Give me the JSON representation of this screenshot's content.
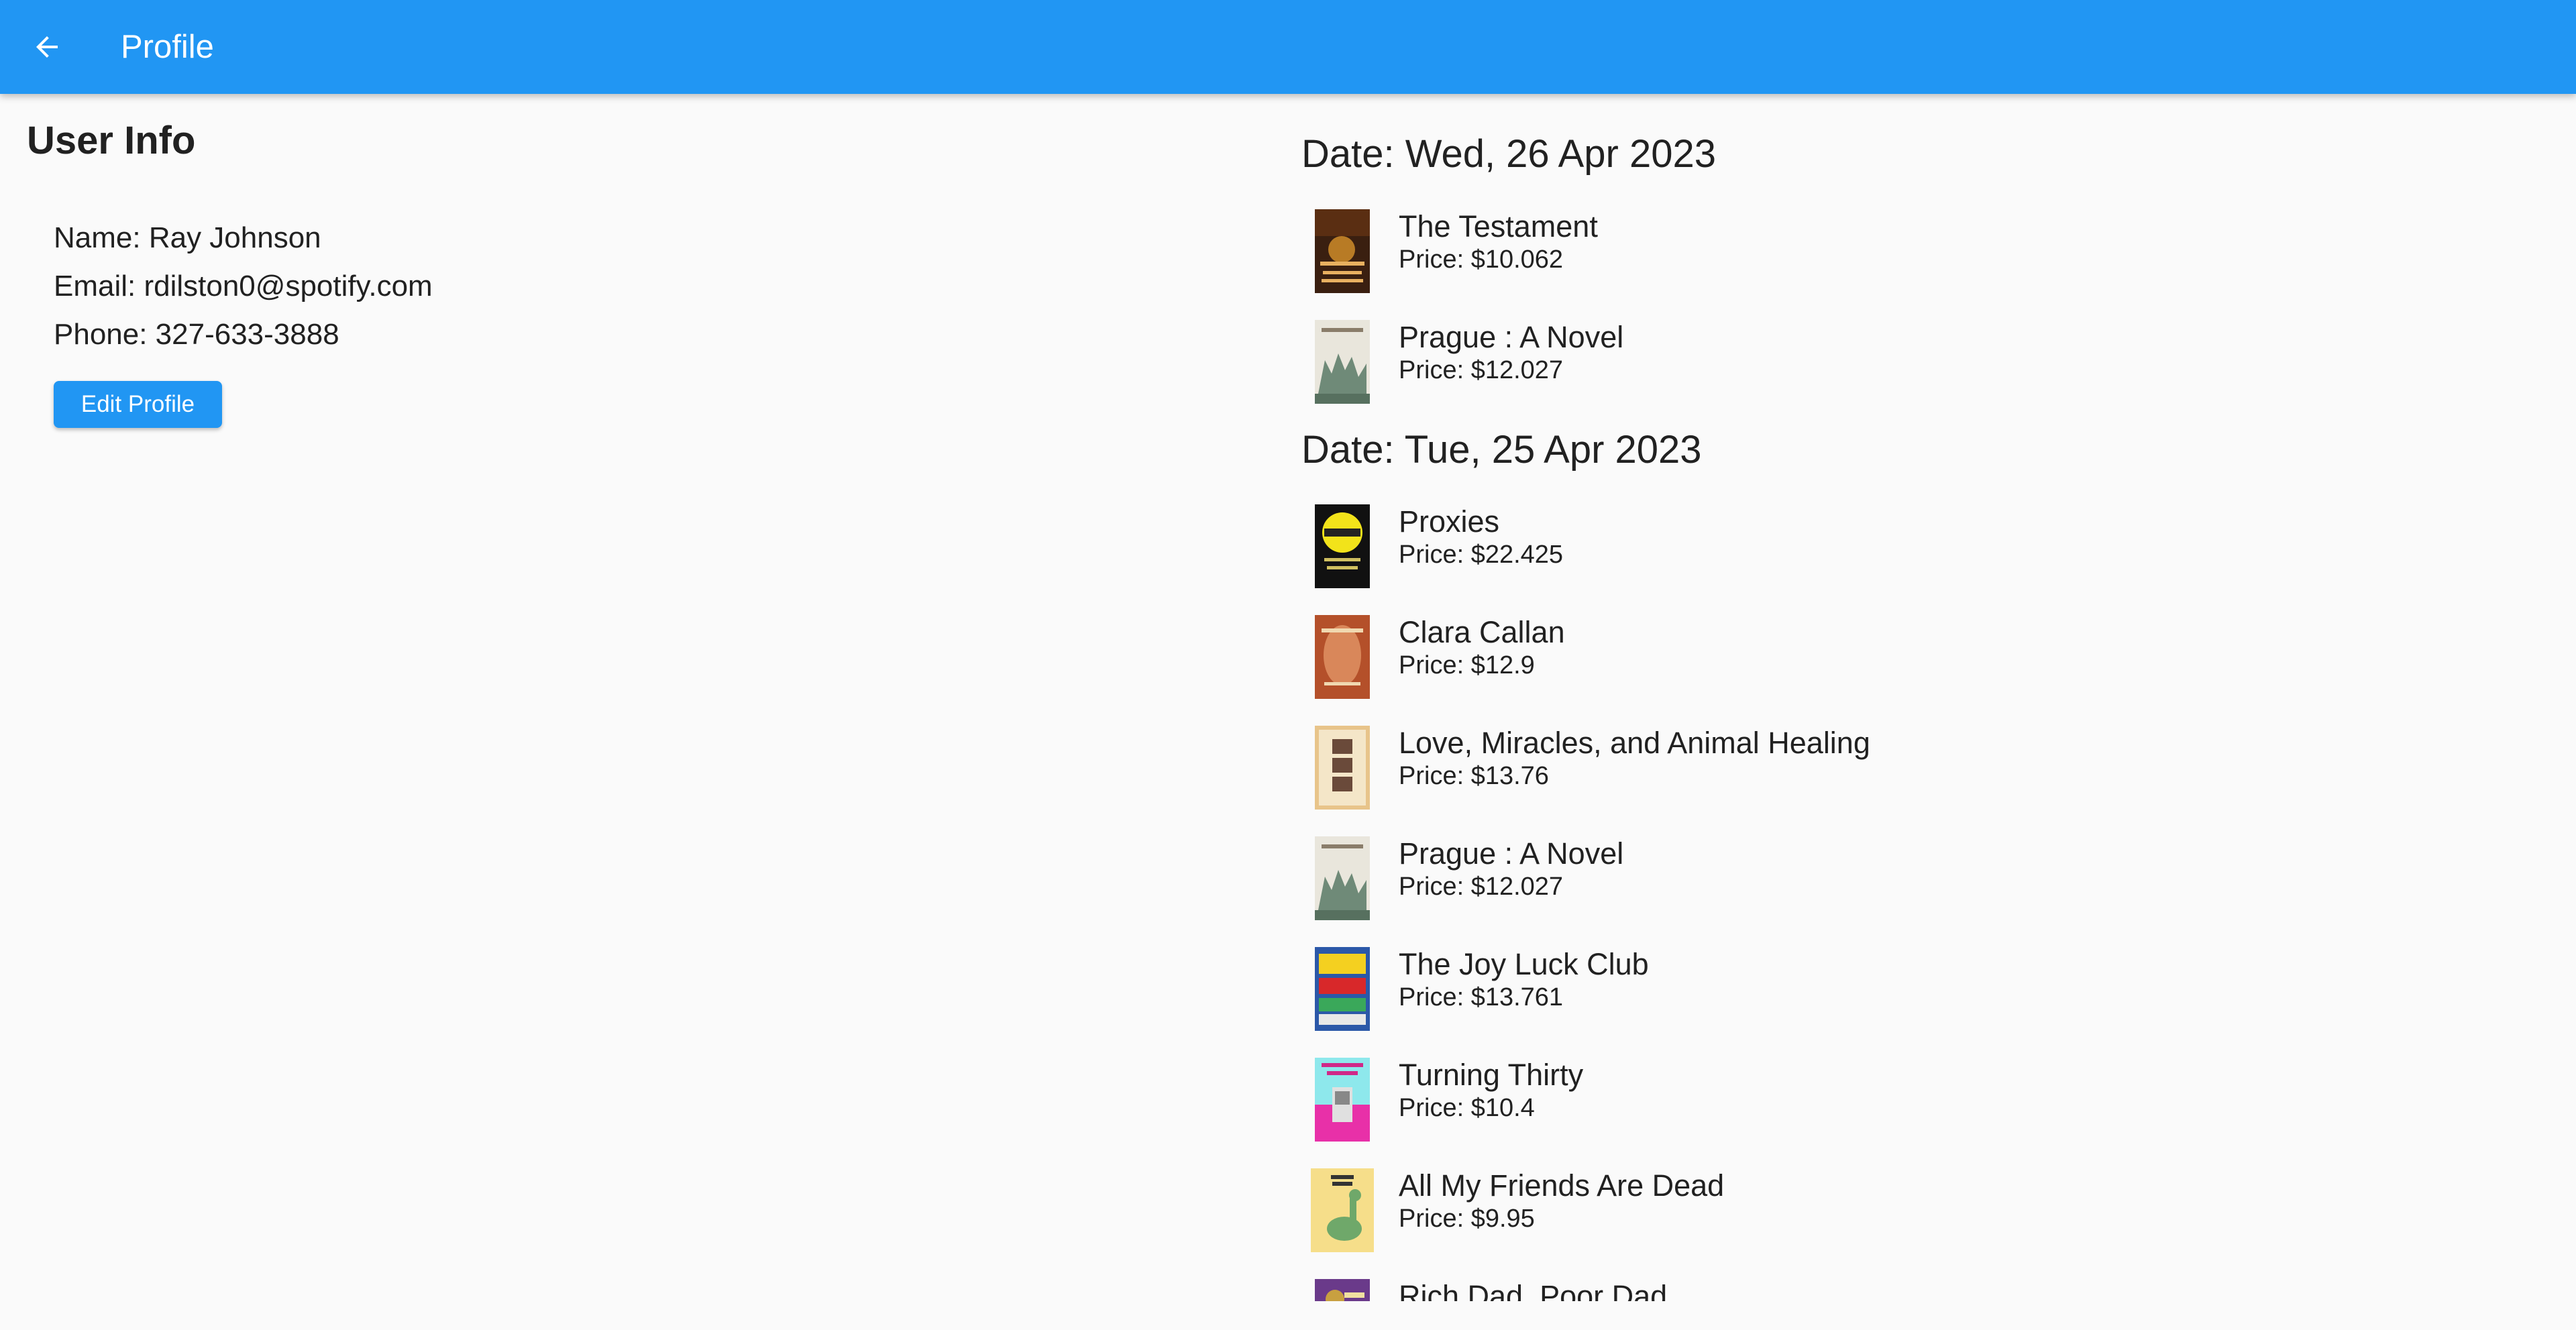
{
  "appbar": {
    "title": "Profile",
    "back_icon": "arrow-left-icon"
  },
  "user_info": {
    "section_title": "User Info",
    "name": "Name: Ray Johnson",
    "email": "Email: rdilston0@spotify.com",
    "phone": "Phone: 327-633-3888",
    "edit_label": "Edit Profile"
  },
  "orders": [
    {
      "date": "Date: Wed, 26 Apr 2023",
      "items": [
        {
          "title": "The Testament",
          "price": "Price: $10.062"
        },
        {
          "title": "Prague : A Novel",
          "price": "Price: $12.027"
        }
      ]
    },
    {
      "date": "Date: Tue, 25 Apr 2023",
      "items": [
        {
          "title": "Proxies",
          "price": "Price: $22.425"
        },
        {
          "title": "Clara Callan",
          "price": "Price: $12.9"
        },
        {
          "title": "Love, Miracles, and Animal Healing",
          "price": "Price: $13.76"
        },
        {
          "title": "Prague : A Novel",
          "price": "Price: $12.027"
        },
        {
          "title": "The Joy Luck Club",
          "price": "Price: $13.761"
        },
        {
          "title": "Turning Thirty",
          "price": "Price: $10.4"
        },
        {
          "title": "All My Friends Are Dead",
          "price": "Price: $9.95"
        },
        {
          "title": "Rich Dad, Poor Dad",
          "price": ""
        }
      ]
    }
  ],
  "colors": {
    "primary": "#2196f3",
    "background": "#fafafa",
    "text": "#212121"
  }
}
